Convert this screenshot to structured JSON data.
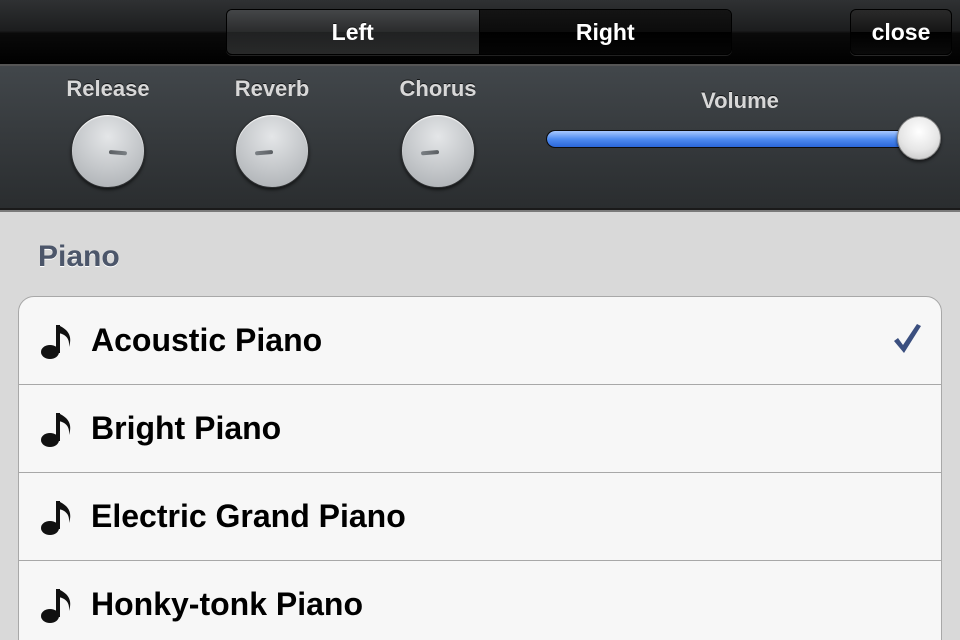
{
  "topbar": {
    "segments": [
      {
        "label": "Left",
        "selected": true
      },
      {
        "label": "Right",
        "selected": false
      }
    ],
    "close_label": "close"
  },
  "controls": {
    "knobs": [
      {
        "label": "Release",
        "level": 0.85
      },
      {
        "label": "Reverb",
        "level": 0.15
      },
      {
        "label": "Chorus",
        "level": 0.15
      }
    ],
    "volume": {
      "label": "Volume",
      "level": 1.0
    }
  },
  "instrument_list": {
    "section_title": "Piano",
    "items": [
      {
        "label": "Acoustic Piano",
        "icon": "music-note-icon",
        "checked": true
      },
      {
        "label": "Bright Piano",
        "icon": "music-note-icon",
        "checked": false
      },
      {
        "label": "Electric Grand Piano",
        "icon": "music-note-icon",
        "checked": false
      },
      {
        "label": "Honky-tonk Piano",
        "icon": "music-note-icon",
        "checked": false
      }
    ]
  },
  "colors": {
    "accent_blue": "#3e6bd8",
    "check_color": "#3b4f7f",
    "section_title_color": "#4c566a"
  }
}
